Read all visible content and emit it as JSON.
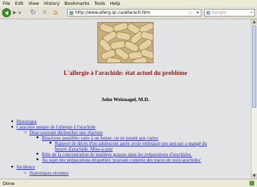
{
  "menu": [
    "File",
    "Edit",
    "View",
    "History",
    "Bookmarks",
    "Tools",
    "Help"
  ],
  "toolbar": {
    "url": "http://www.allerg.qc.ca/allarach.htm",
    "search_placeholder": "Google",
    "search_engine_letter": "G"
  },
  "page": {
    "title": "L'allergie à l'arachide: état actuel du problème",
    "author": "John Weisnagel, M.D.",
    "toc": [
      {
        "level": 1,
        "label": "Historique"
      },
      {
        "level": 1,
        "label": "Caractère unique de l'allergie à l'arachide"
      },
      {
        "level": 2,
        "label": "Dose pouvant déclencher une réaction"
      },
      {
        "level": 3,
        "label": "Réactions possibles suite à un baiser, ou en jouant aux cartes"
      },
      {
        "level": 4,
        "label": "Rapport de décès d'un adolescent après avoir embrassé son ami qui a mangé du beurre d'arachide. Mise-à-jour"
      },
      {
        "level": 3,
        "label": "Rôle de la concentration de matières grasses dans les préparations d'arachides."
      },
      {
        "level": 3,
        "label": "Au sujet des préparations étiquetées 'pouvant contenir des traces de noix/arachides'"
      },
      {
        "level": 1,
        "label": "Incidence"
      },
      {
        "level": 2,
        "label": "Statistiques récentes"
      }
    ]
  },
  "status": {
    "text": "Done"
  }
}
